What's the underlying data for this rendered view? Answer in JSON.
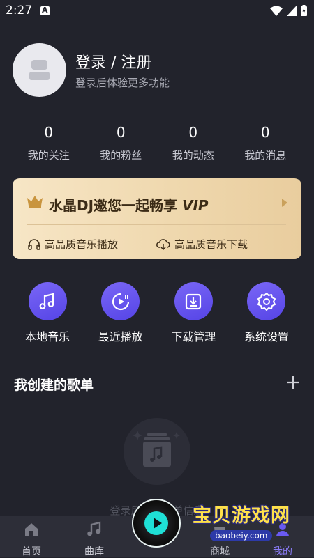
{
  "status_bar": {
    "time": "2:27"
  },
  "profile": {
    "login_title": "登录 / 注册",
    "login_subtitle": "登录后体验更多功能"
  },
  "stats": [
    {
      "value": "0",
      "label": "我的关注"
    },
    {
      "value": "0",
      "label": "我的粉丝"
    },
    {
      "value": "0",
      "label": "我的动态"
    },
    {
      "value": "0",
      "label": "我的消息"
    }
  ],
  "vip": {
    "title": "水晶DJ邀您一起畅享",
    "title_vip": "VIP",
    "feature_1": "高品质音乐播放",
    "feature_2": "高品质音乐下载",
    "colors": {
      "gold_bg": "#efd8ae",
      "crown": "#c9953f"
    }
  },
  "menu": [
    {
      "label": "本地音乐",
      "icon": "music-note-icon"
    },
    {
      "label": "最近播放",
      "icon": "recent-play-icon"
    },
    {
      "label": "下载管理",
      "icon": "download-icon"
    },
    {
      "label": "系统设置",
      "icon": "gear-icon"
    }
  ],
  "playlist": {
    "title": "我创建的歌单",
    "empty_text": "登录后查看歌单信息"
  },
  "tabs": [
    {
      "label": "首页",
      "icon": "home-icon"
    },
    {
      "label": "曲库",
      "icon": "music-library-icon"
    },
    {
      "label": "",
      "icon": "play-disc-icon"
    },
    {
      "label": "商城",
      "icon": "shop-icon"
    },
    {
      "label": "我的",
      "icon": "user-icon"
    }
  ],
  "watermark": {
    "main": "宝贝游戏网",
    "sub": "baobeiy.com"
  },
  "colors": {
    "background": "#22232c",
    "accent": "#6a5af2",
    "tab_bg": "#2d2e38",
    "teal": "#1fe0d6"
  }
}
